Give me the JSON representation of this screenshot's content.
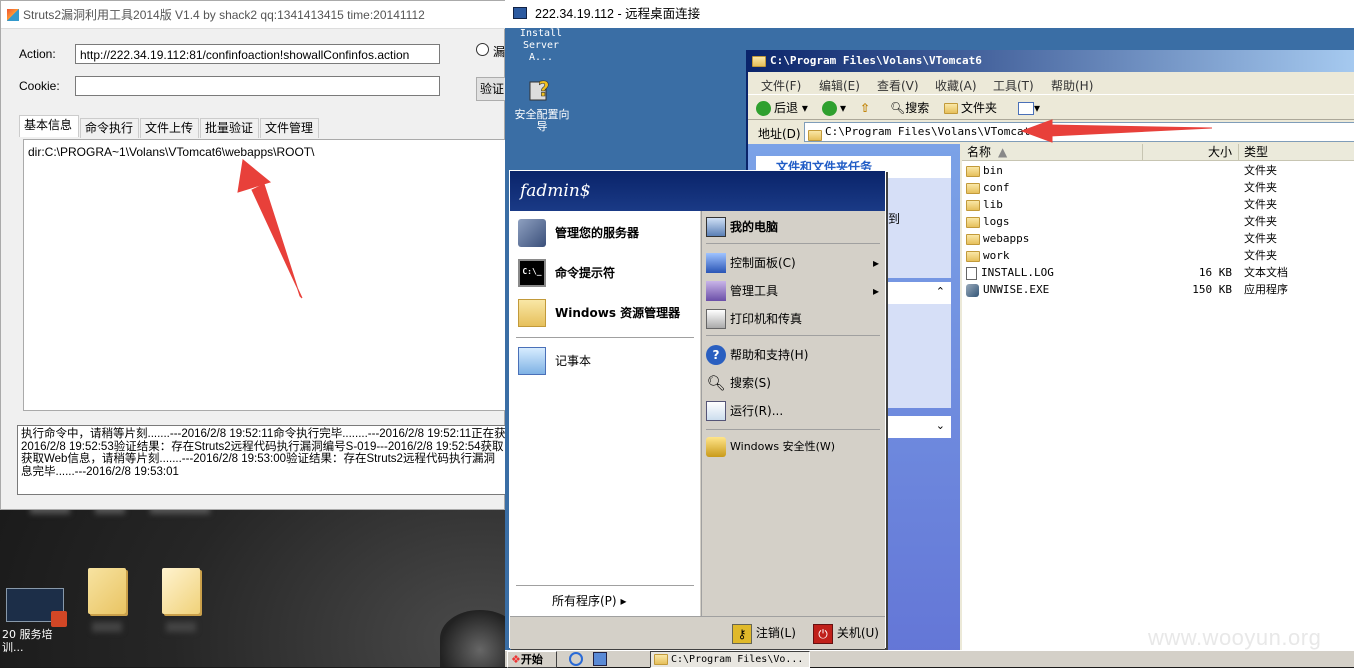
{
  "tool": {
    "title": "Struts2漏洞利用工具2014版 V1.4 by shack2 qq:1341413415 time:20141112",
    "action_label": "Action:",
    "action_value": "http://222.34.19.112:81/confinfoaction!showallConfinfos.action",
    "cookie_label": "Cookie:",
    "cookie_value": "",
    "radio_label": "漏",
    "verify_btn": "验证",
    "tabs": [
      "基本信息",
      "命令执行",
      "文件上传",
      "批量验证",
      "文件管理"
    ],
    "info_text": "dir:C:\\PROGRA~1\\Volans\\VTomcat6\\webapps\\ROOT\\",
    "log_lines": [
      "执行命令中，请稍等片刻.......---2016/2/8 19:52:11命令执行完毕........---2016/2/8 19:52:11正在获",
      "2016/2/8 19:52:53验证结果：存在Struts2远程代码执行漏洞编号S-019---2016/2/8 19:52:54获取",
      "获取Web信息，请稍等片刻.......---2016/2/8 19:53:00验证结果：存在Struts2远程代码执行漏洞",
      "息完毕......---2016/2/8 19:53:01"
    ]
  },
  "rdp": {
    "title": "222.34.19.112 - 远程桌面连接",
    "desktop_icons": [
      {
        "label": "Install Server A..."
      },
      {
        "label": "安全配置向导"
      }
    ]
  },
  "explorer": {
    "title": "C:\\Program Files\\Volans\\VTomcat6",
    "menu": [
      "文件(F)",
      "编辑(E)",
      "查看(V)",
      "收藏(A)",
      "工具(T)",
      "帮助(H)"
    ],
    "toolbar": {
      "back": "后退",
      "search": "搜索",
      "folders": "文件夹"
    },
    "address_label": "地址(D)",
    "address_value": "C:\\Program Files\\Volans\\VTomcat6",
    "columns": {
      "name": "名称",
      "size": "大小",
      "type": "类型"
    },
    "task_pane_fragments": [
      "文件和文件夹任务",
      "夹",
      "布到"
    ],
    "files": [
      {
        "name": "bin",
        "size": "",
        "type": "文件夹",
        "kind": "folder"
      },
      {
        "name": "conf",
        "size": "",
        "type": "文件夹",
        "kind": "folder"
      },
      {
        "name": "lib",
        "size": "",
        "type": "文件夹",
        "kind": "folder"
      },
      {
        "name": "logs",
        "size": "",
        "type": "文件夹",
        "kind": "folder"
      },
      {
        "name": "webapps",
        "size": "",
        "type": "文件夹",
        "kind": "folder"
      },
      {
        "name": "work",
        "size": "",
        "type": "文件夹",
        "kind": "folder"
      },
      {
        "name": "INSTALL.LOG",
        "size": "16 KB",
        "type": "文本文档",
        "kind": "text"
      },
      {
        "name": "UNWISE.EXE",
        "size": "150 KB",
        "type": "应用程序",
        "kind": "exe"
      }
    ]
  },
  "startmenu": {
    "user": "fadmin$",
    "left_items": [
      {
        "label": "管理您的服务器"
      },
      {
        "label": "命令提示符"
      },
      {
        "label": "Windows 资源管理器"
      },
      {
        "label": "记事本"
      }
    ],
    "all_programs": "所有程序(P)",
    "right_items": [
      {
        "label": "我的电脑"
      },
      {
        "label": "控制面板(C)"
      },
      {
        "label": "管理工具"
      },
      {
        "label": "打印机和传真"
      },
      {
        "label": "帮助和支持(H)"
      },
      {
        "label": "搜索(S)"
      },
      {
        "label": "运行(R)..."
      },
      {
        "label": "Windows 安全性(W)"
      }
    ],
    "logoff": "注销(L)",
    "shutdown": "关机(U)"
  },
  "taskbar": {
    "start": "开始",
    "window_button": "C:\\Program Files\\Vo..."
  },
  "desktop": {
    "icon_label": "20 服务培训..."
  },
  "watermark": "www.wooyun.org",
  "colors": {
    "accent_red": "#e8403a",
    "xp_title": "#0a246a",
    "desktop_blue": "#3a6ea5"
  }
}
